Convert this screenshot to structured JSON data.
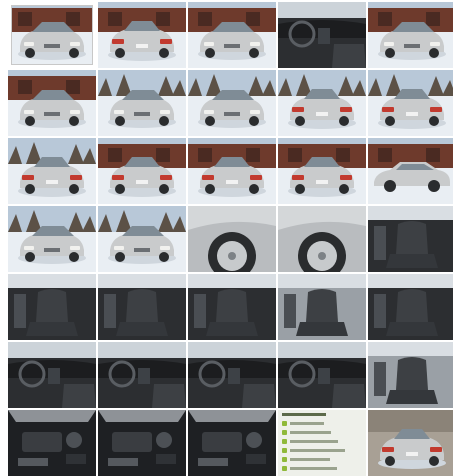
{
  "gallery": {
    "colors": {
      "snow": "#e9eef3",
      "silver_car": "#c9cbcc",
      "shadow": "#6b6f73",
      "sky": "#b8c8d8",
      "brick": "#6e3a2c",
      "interior": "#2c2e31",
      "seat": "#3d4044",
      "engine": "#1e2023",
      "tail": "#c23a2e",
      "note_accent": "#8fb93a"
    },
    "tiles": [
      {
        "kind": "car-front",
        "variant": "selected"
      },
      {
        "kind": "car-rear",
        "variant": "building"
      },
      {
        "kind": "car-front",
        "variant": "building"
      },
      {
        "kind": "interior-dash",
        "variant": "dark"
      },
      {
        "kind": "car-front",
        "variant": "building"
      },
      {
        "kind": "car-front",
        "variant": "building"
      },
      {
        "kind": "car-front",
        "variant": "trees"
      },
      {
        "kind": "car-front",
        "variant": "trees"
      },
      {
        "kind": "car-rear",
        "variant": "trees"
      },
      {
        "kind": "car-rear",
        "variant": "trees"
      },
      {
        "kind": "car-rear",
        "variant": "trees"
      },
      {
        "kind": "car-rear",
        "variant": "building"
      },
      {
        "kind": "car-rear",
        "variant": "building"
      },
      {
        "kind": "car-rear",
        "variant": "building"
      },
      {
        "kind": "car-side",
        "variant": "building"
      },
      {
        "kind": "car-front",
        "variant": "trees"
      },
      {
        "kind": "car-front",
        "variant": "trees"
      },
      {
        "kind": "wheel",
        "variant": "close"
      },
      {
        "kind": "wheel",
        "variant": "close"
      },
      {
        "kind": "interior-seat",
        "variant": "dark"
      },
      {
        "kind": "interior-seat",
        "variant": "dark"
      },
      {
        "kind": "interior-seat",
        "variant": "dark"
      },
      {
        "kind": "interior-seat",
        "variant": "dark"
      },
      {
        "kind": "interior-seat",
        "variant": "light"
      },
      {
        "kind": "interior-seat",
        "variant": "dark"
      },
      {
        "kind": "interior-dash",
        "variant": "dark"
      },
      {
        "kind": "interior-dash",
        "variant": "dark"
      },
      {
        "kind": "interior-dash",
        "variant": "dark"
      },
      {
        "kind": "interior-dash",
        "variant": "dark"
      },
      {
        "kind": "interior-seat",
        "variant": "light"
      },
      {
        "kind": "engine",
        "variant": "dark"
      },
      {
        "kind": "engine",
        "variant": "dark"
      },
      {
        "kind": "engine",
        "variant": "dark"
      },
      {
        "kind": "note",
        "variant": "list"
      },
      {
        "kind": "car-rear",
        "variant": "garage"
      }
    ]
  }
}
